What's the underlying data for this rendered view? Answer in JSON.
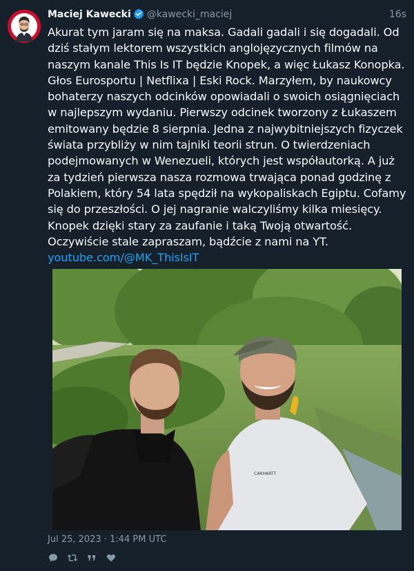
{
  "tweet": {
    "author_name": "Maciej Kawecki",
    "author_handle": "@kawecki_maciej",
    "verified": true,
    "time_ago": "16s",
    "text": "Akurat tym jaram się na maksa. Gadali gadali i się dogadali. Od dziś stałym lektorem wszystkich anglojęzycznych filmów na naszym kanale This Is IT będzie Knopek, a więc Łukasz Konopka. Głos Eurosportu | Netflixa | Eski Rock. Marzyłem, by naukowcy bohaterzy naszych odcinków opowiadali o swoich osiągnięciach w najlepszym wydaniu. Pierwszy odcinek tworzony z Łukaszem emitowany będzie 8 sierpnia. Jedna z najwybitniejszych fizyczek świata przybliży w nim tajniki teorii strun. O twierdzeniach podejmowanych w Wenezueli, których jest współautorką. A już za tydzień pierwsza nasza rozmowa trwająca ponad godzinę z Polakiem, który 54 lata spędził na wykopaliskach Egiptu. Cofamy się do przeszłości. O jej nagranie walczyliśmy kilka miesięcy. Knopek dzięki stary za zaufanie i taką Twoją otwartość. Oczywiście stale zapraszam, bądźcie z nami na YT.",
    "link_text": "youtube.com/@MK_ThisIsIT",
    "timestamp": "Jul 25, 2023 · 1:44 PM UTC",
    "photo_shirt_text": "CARHARTT"
  },
  "actions": {
    "reply_icon": "comment-icon",
    "retweet_icon": "retweet-icon",
    "quote_icon": "quote-icon",
    "like_icon": "heart-icon"
  },
  "colors": {
    "background": "#15202b",
    "text": "#f5f8fa",
    "muted": "#8899a6",
    "link": "#1da1f2",
    "verified": "#1da1f2"
  }
}
